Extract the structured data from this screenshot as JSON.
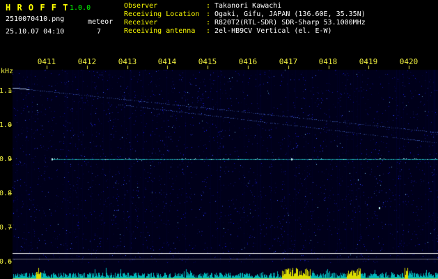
{
  "header": {
    "app_name": "H R O F F T",
    "version": "1.0.0",
    "filename": "2510070410.png",
    "mode": "meteor",
    "datetime": "25.10.07 04:10",
    "count": "7",
    "sep": ":",
    "info": [
      {
        "label": "Observer",
        "value": "Takanori Kawachi"
      },
      {
        "label": "Receiving Location",
        "value": "Ogaki, Gifu, JAPAN (136.60E, 35.35N)"
      },
      {
        "label": "Receiver",
        "value": "R820T2(RTL-SDR) SDR-Sharp 53.1000MHz"
      },
      {
        "label": "Receiving antenna",
        "value": "2el-HB9CV Vertical (el. E-W)"
      }
    ],
    "colors": {
      "label_yellow": "#ffff00",
      "value_white": "#ffffff",
      "version_green": "#00ff00"
    }
  },
  "chart_data": {
    "type": "heatmap",
    "title": "HROFFT radio meteor echo spectrogram with signal-level strip",
    "y_unit": "kHz",
    "x_ticks": [
      "0411",
      "0412",
      "0413",
      "0414",
      "0415",
      "0416",
      "0417",
      "0418",
      "0419",
      "0420"
    ],
    "y_ticks": [
      "1.1",
      "1.0",
      "0.9",
      "0.8",
      "0.7",
      "0.6"
    ],
    "y_range_khz": [
      0.56,
      1.16
    ],
    "legend": "none",
    "grid": "off",
    "traces": [
      {
        "name": "direct-carrier",
        "kind": "horizontal",
        "khz": 0.9,
        "x_start": 0.093,
        "x_end": 1.0,
        "color": "#28e6e6",
        "bright_start": true
      },
      {
        "name": "doppler-trail-upper",
        "kind": "diagonal",
        "x_start": 0.0,
        "khz_start": 1.108,
        "x_end": 1.0,
        "khz_end": 0.978,
        "color": "#5a82ff",
        "bright_start": true
      },
      {
        "name": "doppler-trail-lower",
        "kind": "diagonal",
        "x_start": 0.25,
        "khz_start": 1.06,
        "x_end": 1.0,
        "khz_end": 0.947,
        "color": "#3c5ce0",
        "bright_start": false
      }
    ],
    "hlines": [
      {
        "khz": 0.625,
        "color": "rgba(255,255,255,0.95)"
      },
      {
        "khz": 0.608,
        "color": "rgba(190,190,190,0.55)"
      }
    ],
    "echo_spots": [
      {
        "x": 0.093,
        "khz": 0.9
      },
      {
        "x": 0.655,
        "khz": 0.9
      },
      {
        "x": 0.862,
        "khz": 0.757
      }
    ],
    "level_strip": {
      "bar_color": "rgba(0,205,205,0.9)",
      "yellow_color": "rgba(232,232,0,0.95)",
      "baseline_color": "rgba(220,220,60,0.7)",
      "yellow_ranges": [
        [
          0.055,
          0.066
        ],
        [
          0.633,
          0.7
        ],
        [
          0.784,
          0.818
        ],
        [
          0.92,
          0.928
        ]
      ]
    },
    "colors": {
      "noise_bg": "#00001a",
      "tick_yellow": "#f0f040"
    }
  }
}
